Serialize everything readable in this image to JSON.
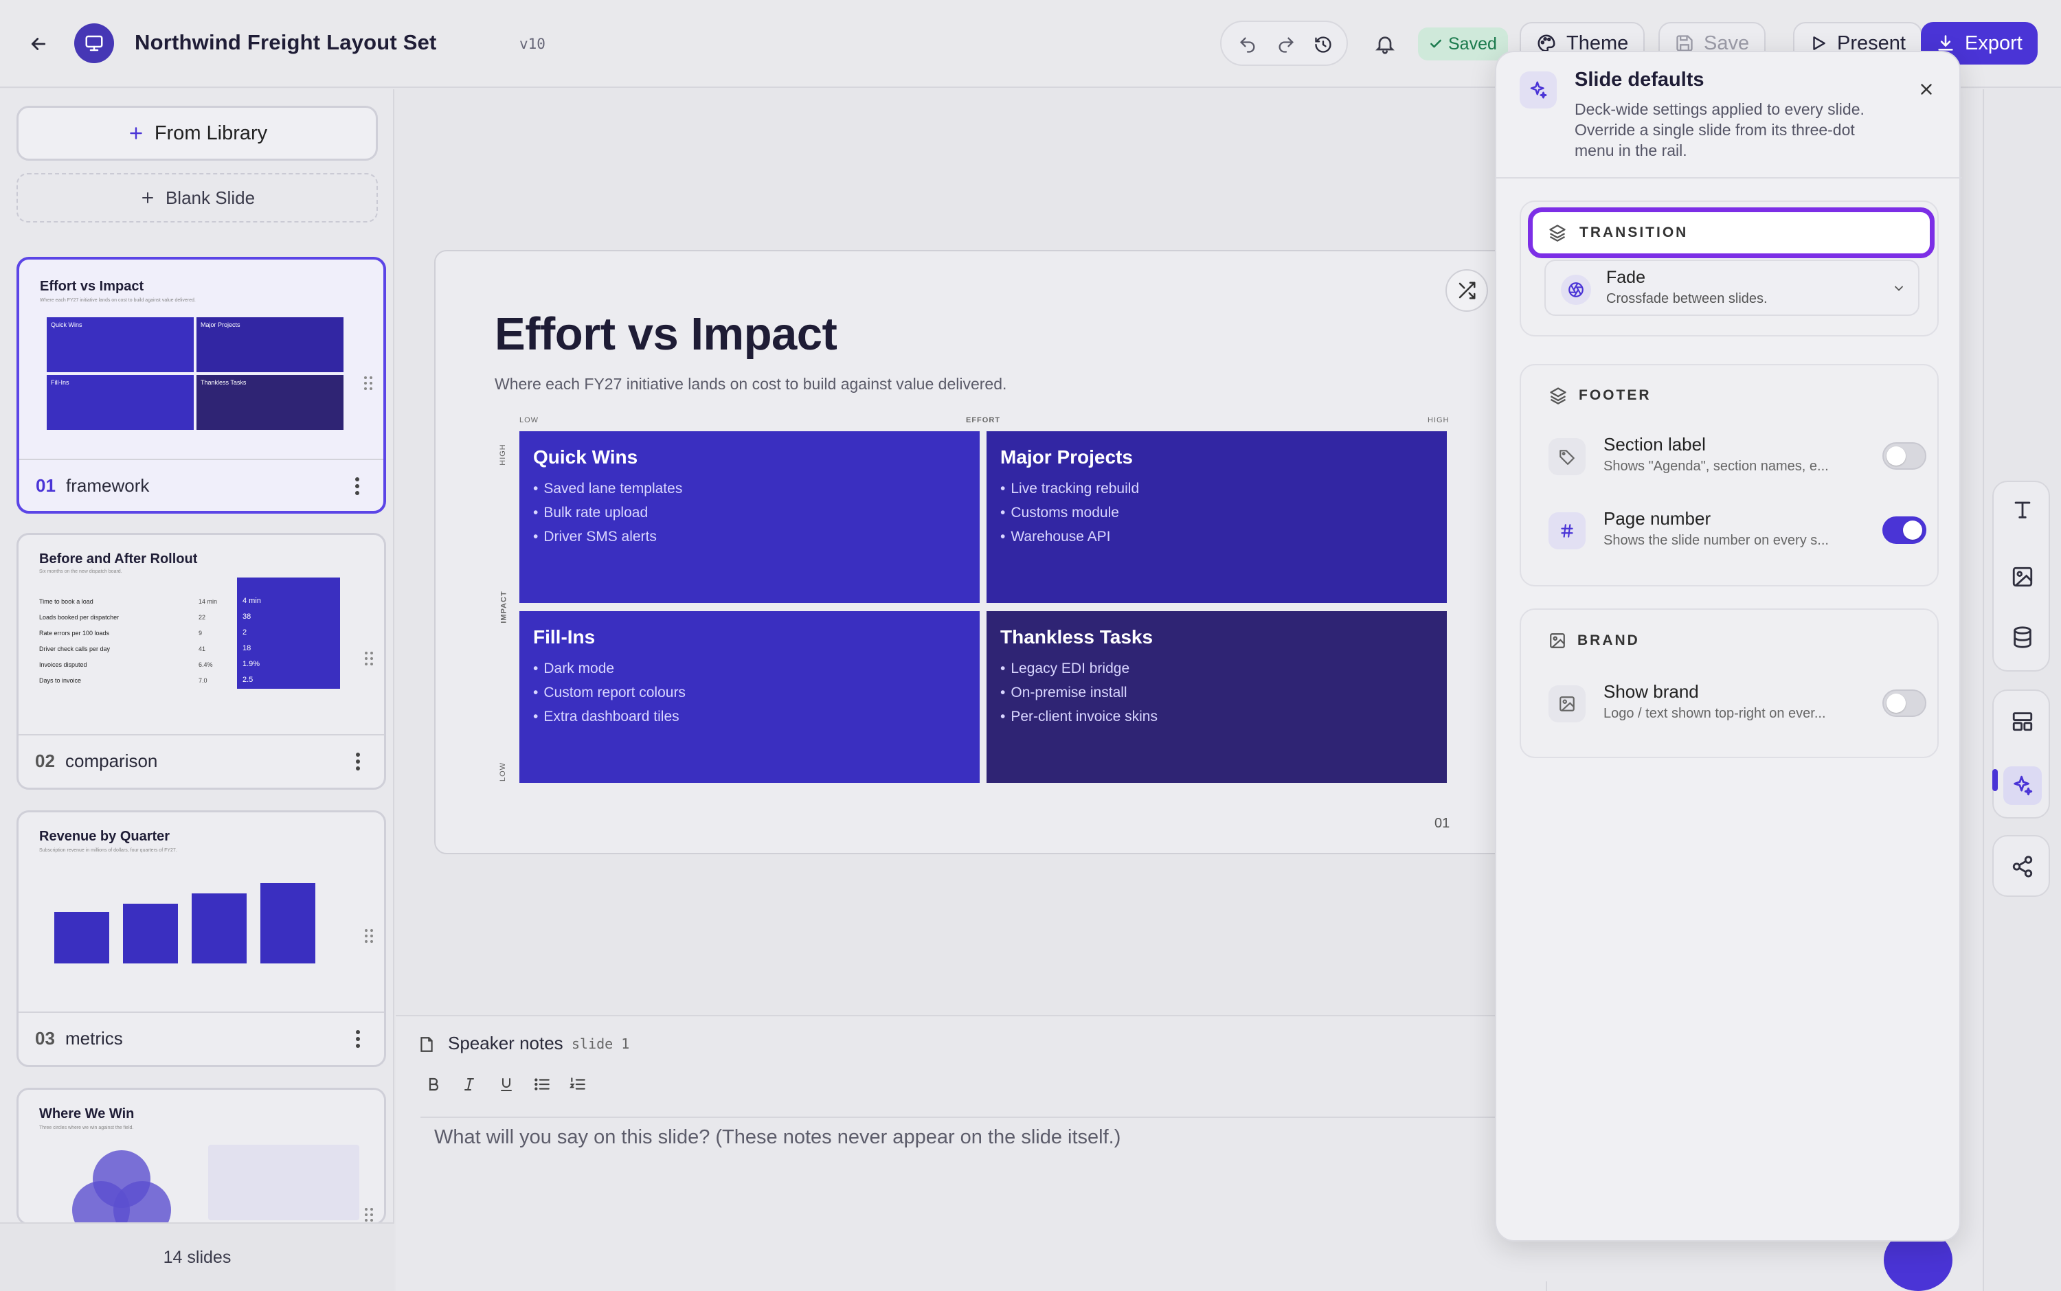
{
  "header": {
    "title": "Northwind Freight Layout Set",
    "version": "v10",
    "saved_label": "Saved",
    "theme_label": "Theme",
    "save_label": "Save",
    "present_label": "Present",
    "export_label": "Export"
  },
  "rail": {
    "from_library": "From Library",
    "blank_slide": "Blank Slide",
    "slide_count": "14 slides",
    "thumbnails": [
      {
        "num": "01",
        "name": "framework",
        "title": "Effort vs Impact",
        "subtitle": "Where each FY27 initiative lands on cost to build against value delivered.",
        "quads": [
          "Quick Wins",
          "Major Projects",
          "Fill-Ins",
          "Thankless Tasks"
        ]
      },
      {
        "num": "02",
        "name": "comparison",
        "title": "Before and After Rollout",
        "subtitle": "Six months on the new dispatch board.",
        "rows": [
          {
            "label": "Time to book a load",
            "before": "14 min",
            "after": "4 min"
          },
          {
            "label": "Loads booked per dispatcher",
            "before": "22",
            "after": "38"
          },
          {
            "label": "Rate errors per 100 loads",
            "before": "9",
            "after": "2"
          },
          {
            "label": "Driver check calls per day",
            "before": "41",
            "after": "18"
          },
          {
            "label": "Invoices disputed",
            "before": "6.4%",
            "after": "1.9%"
          },
          {
            "label": "Days to invoice",
            "before": "7.0",
            "after": "2.5"
          }
        ]
      },
      {
        "num": "03",
        "name": "metrics",
        "title": "Revenue by Quarter",
        "subtitle": "Subscription revenue in millions of dollars, four quarters of FY27.",
        "bars": [
          0.5,
          0.58,
          0.68,
          0.78
        ]
      },
      {
        "num": "04",
        "name": "",
        "title": "Where We Win",
        "subtitle": "Three circles where we win against the field."
      }
    ]
  },
  "slide": {
    "title": "Effort vs Impact",
    "subtitle": "Where each FY27 initiative lands on cost to build against value delivered.",
    "axis_low_x": "LOW",
    "axis_effort": "EFFORT",
    "axis_high_x": "HIGH",
    "axis_high_y": "HIGH",
    "axis_impact": "IMPACT",
    "axis_low_y": "LOW",
    "page_number": "01",
    "quadrants": [
      {
        "title": "Quick Wins",
        "items": [
          "Saved lane templates",
          "Bulk rate upload",
          "Driver SMS alerts"
        ],
        "color": "#3a2fc0"
      },
      {
        "title": "Major Projects",
        "items": [
          "Live tracking rebuild",
          "Customs module",
          "Warehouse API"
        ],
        "color": "#3226a3"
      },
      {
        "title": "Fill-Ins",
        "items": [
          "Dark mode",
          "Custom report colours",
          "Extra dashboard tiles"
        ],
        "color": "#3a2fc0"
      },
      {
        "title": "Thankless Tasks",
        "items": [
          "Legacy EDI bridge",
          "On-premise install",
          "Per-client invoice skins"
        ],
        "color": "#2f2474"
      }
    ]
  },
  "notes": {
    "label": "Speaker notes",
    "slide_ref": "slide 1",
    "placeholder": "What will you say on this slide? (These notes never appear on the slide itself.)"
  },
  "panel": {
    "title": "Slide defaults",
    "description": "Deck-wide settings applied to every slide. Override a single slide from its three-dot menu in the rail.",
    "transition": {
      "heading": "TRANSITION",
      "selected": "Fade",
      "selected_desc": "Crossfade between slides."
    },
    "footer": {
      "heading": "FOOTER",
      "section_label": {
        "title": "Section label",
        "desc": "Shows \"Agenda\", section names, e...",
        "enabled": false
      },
      "page_number": {
        "title": "Page number",
        "desc": "Shows the slide number on every s...",
        "enabled": true
      }
    },
    "brand": {
      "heading": "BRAND",
      "show_brand": {
        "title": "Show brand",
        "desc": "Logo / text shown top-right on ever...",
        "enabled": false
      }
    }
  },
  "colors": {
    "accent": "#4a34d6",
    "focus_ring": "#7c2ee6",
    "saved_green": "#1b7a4d"
  }
}
